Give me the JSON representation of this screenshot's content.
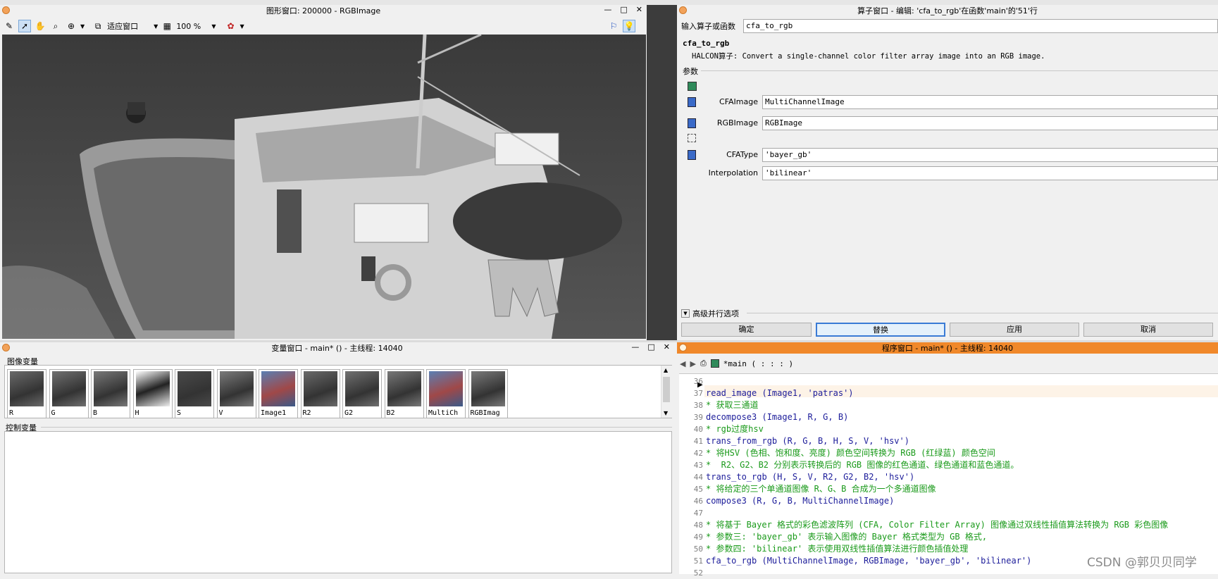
{
  "graphics_window": {
    "title": "图形窗口: 200000 - RGBImage",
    "fit_label": "适应窗口",
    "zoom_label": "100 %"
  },
  "operator_window": {
    "title": "算子窗口 - 编辑: 'cfa_to_rgb'在函数'main'的'51'行",
    "input_label": "输入算子或函数",
    "input_value": "cfa_to_rgb",
    "op_name": "cfa_to_rgb",
    "op_desc": "HALCON算子: Convert a single-channel color filter array image into an RGB image.",
    "params_label": "参数",
    "params": [
      {
        "label": "CFAImage",
        "value": "MultiChannelImage"
      },
      {
        "label": "RGBImage",
        "value": "RGBImage"
      },
      {
        "label": "CFAType",
        "value": "'bayer_gb'"
      },
      {
        "label": "Interpolation",
        "value": "'bilinear'"
      }
    ],
    "advanced_label": "高级并行选项",
    "buttons": {
      "ok": "确定",
      "replace": "替换",
      "apply": "应用",
      "cancel": "取消"
    }
  },
  "variable_window": {
    "title": "变量窗口 - main* () - 主线程: 14040",
    "image_vars_label": "图像变量",
    "image_vars": [
      "R",
      "G",
      "B",
      "H",
      "S",
      "V",
      "Image1",
      "R2",
      "G2",
      "B2",
      "MultiCh",
      "RGBImag"
    ],
    "control_vars_label": "控制变量"
  },
  "program_window": {
    "title": "程序窗口 - main* () - 主线程: 14040",
    "tab_label": "*main ( : : : )",
    "lines": [
      {
        "n": "36",
        "t": "",
        "k": "op"
      },
      {
        "n": "37",
        "t": "read_image (Image1, 'patras')",
        "k": "op"
      },
      {
        "n": "38",
        "t": "* 获取三通道",
        "k": "cm"
      },
      {
        "n": "39",
        "t": "decompose3 (Image1, R, G, B)",
        "k": "op"
      },
      {
        "n": "40",
        "t": "* rgb过度hsv",
        "k": "cm"
      },
      {
        "n": "41",
        "t": "trans_from_rgb (R, G, B, H, S, V, 'hsv')",
        "k": "op"
      },
      {
        "n": "42",
        "t": "* 将HSV (色相、饱和度、亮度) 颜色空间转换为 RGB (红绿蓝) 颜色空间",
        "k": "cm"
      },
      {
        "n": "43",
        "t": "*  R2、G2、B2 分别表示转换后的 RGB 图像的红色通道、绿色通道和蓝色通道。",
        "k": "cm"
      },
      {
        "n": "44",
        "t": "trans_to_rgb (H, S, V, R2, G2, B2, 'hsv')",
        "k": "op"
      },
      {
        "n": "45",
        "t": "* 将给定的三个单通道图像 R、G、B 合成为一个多通道图像",
        "k": "cm"
      },
      {
        "n": "46",
        "t": "compose3 (R, G, B, MultiChannelImage)",
        "k": "op"
      },
      {
        "n": "47",
        "t": "",
        "k": "op"
      },
      {
        "n": "48",
        "t": "* 将基于 Bayer 格式的彩色滤波阵列 (CFA, Color Filter Array) 图像通过双线性插值算法转换为 RGB 彩色图像",
        "k": "cm"
      },
      {
        "n": "49",
        "t": "* 参数三: 'bayer_gb' 表示输入图像的 Bayer 格式类型为 GB 格式,",
        "k": "cm"
      },
      {
        "n": "50",
        "t": "* 参数四: 'bilinear' 表示使用双线性插值算法进行颜色插值处理",
        "k": "cm"
      },
      {
        "n": "51",
        "t": "cfa_to_rgb (MultiChannelImage, RGBImage, 'bayer_gb', 'bilinear')",
        "k": "op"
      },
      {
        "n": "52",
        "t": "",
        "k": "op"
      }
    ]
  },
  "watermark": "CSDN @郭贝贝同学",
  "colors": {
    "accent": "#f0882a",
    "op": "#1c1c9a",
    "comment": "#1a9a1a"
  }
}
